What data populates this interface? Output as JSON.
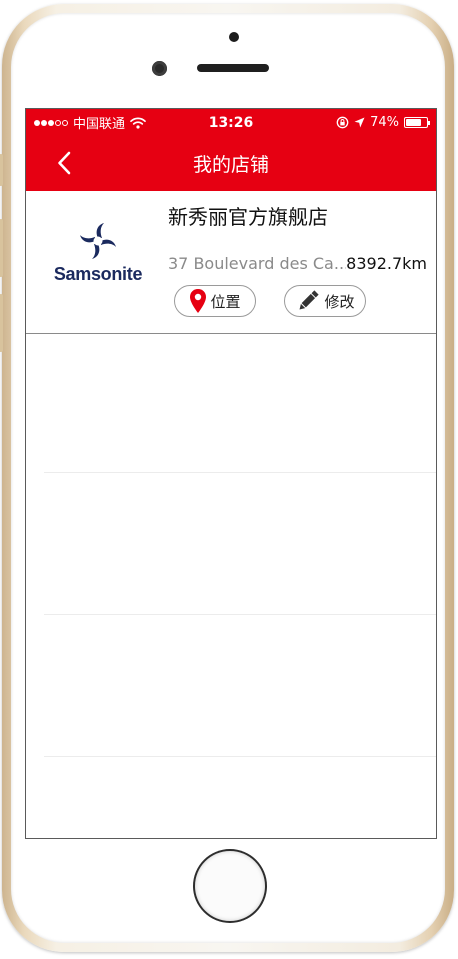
{
  "status_bar": {
    "carrier": "中国联通",
    "time": "13:26",
    "battery": "74%",
    "battery_level": 0.74,
    "signal_bars_filled": 3,
    "signal_bars_total": 5
  },
  "nav": {
    "back_icon": "chevron-left-icon",
    "title": "我的店铺"
  },
  "store": {
    "logo_text": "Samsonite",
    "name": "新秀丽官方旗舰店",
    "address": "37 Boulevard des Ca...",
    "distance": "8392.7km",
    "location_button": {
      "label": "位置",
      "icon": "map-pin-icon"
    },
    "edit_button": {
      "label": "修改",
      "icon": "pencil-icon"
    }
  },
  "colors": {
    "brand_red": "#e60012",
    "logo_navy": "#1b2a5e",
    "pin_red": "#e60012"
  }
}
